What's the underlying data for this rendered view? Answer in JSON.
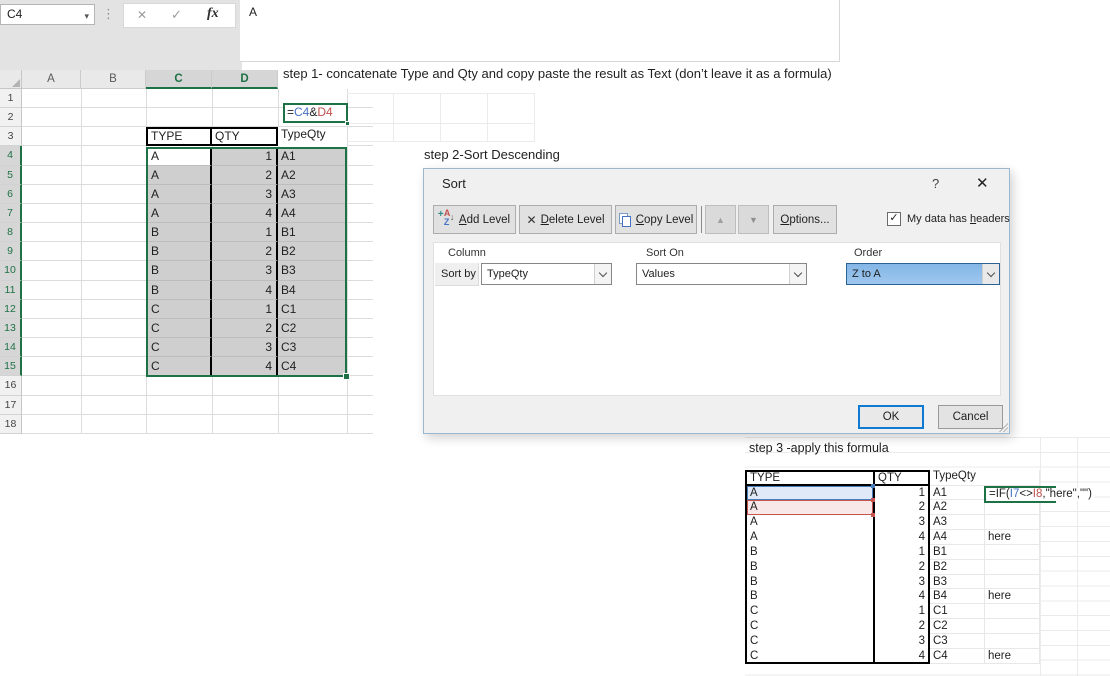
{
  "chrome": {
    "name_box": "C4",
    "formula_bar_value": "A"
  },
  "icons": {
    "name_dropdown": "▾",
    "dots": "⋮",
    "formula_cancel": "✕",
    "formula_enter": "✓",
    "fx": "fx",
    "help": "?",
    "close": "✕",
    "up_arrow": "▲",
    "down_arrow": "▼",
    "delete_x": "✕",
    "check": "✓",
    "add_plus": "+",
    "add_a": "A",
    "add_z": "Z",
    "add_down": "↓"
  },
  "grid": {
    "column_headers": [
      {
        "label": "A",
        "selected": false
      },
      {
        "label": "B",
        "selected": false
      },
      {
        "label": "C",
        "selected": true
      },
      {
        "label": "D",
        "selected": true
      }
    ],
    "rows_total": 18,
    "selected_row_start": 4,
    "selected_row_end": 15,
    "table": {
      "headers": [
        "TYPE",
        "QTY",
        "TypeQty"
      ],
      "types": [
        "A",
        "A",
        "A",
        "A",
        "B",
        "B",
        "B",
        "B",
        "C",
        "C",
        "C",
        "C"
      ],
      "qty": [
        1,
        2,
        3,
        4,
        1,
        2,
        3,
        4,
        1,
        2,
        3,
        4
      ],
      "typeqty": [
        "A1",
        "A2",
        "A3",
        "A4",
        "B1",
        "B2",
        "B3",
        "B4",
        "C1",
        "C2",
        "C3",
        "C4"
      ]
    }
  },
  "step1": {
    "label": "step 1- concatenate Type and Qty and copy paste the result as Text (don’t leave it as a formula)",
    "formula": [
      {
        "t": "="
      },
      {
        "t": "C4",
        "c": "blue"
      },
      {
        "t": "&"
      },
      {
        "t": "D4",
        "c": "red"
      }
    ]
  },
  "step2": {
    "label": "step 2-Sort Descending"
  },
  "sort_dialog": {
    "title": "Sort",
    "toolbar": {
      "add": {
        "label": "Add Level",
        "upos": 0
      },
      "delete": {
        "label": "Delete Level",
        "upos": 0
      },
      "copy": {
        "label": "Copy Level",
        "upos": 0
      },
      "options": {
        "label": "Options...",
        "upos": 0
      },
      "headers_checkbox": {
        "label": "My data has headers",
        "upos": 12,
        "checked": true
      }
    },
    "list_headers": [
      "Column",
      "Sort On",
      "Order"
    ],
    "sort_row": {
      "label": "Sort by",
      "column": "TypeQty",
      "sort_on": "Values",
      "order": "Z to A"
    },
    "ok": "OK",
    "cancel": "Cancel"
  },
  "step3": {
    "label": "step 3 -apply this formula",
    "table": {
      "headers": [
        "TYPE",
        "QTY",
        "TypeQty",
        ""
      ],
      "rows": [
        {
          "type": "A",
          "qty": 1,
          "typeqty": "A1",
          "note": ""
        },
        {
          "type": "A",
          "qty": 2,
          "typeqty": "A2",
          "note": ""
        },
        {
          "type": "A",
          "qty": 3,
          "typeqty": "A3",
          "note": ""
        },
        {
          "type": "A",
          "qty": 4,
          "typeqty": "A4",
          "note": "here"
        },
        {
          "type": "B",
          "qty": 1,
          "typeqty": "B1",
          "note": ""
        },
        {
          "type": "B",
          "qty": 2,
          "typeqty": "B2",
          "note": ""
        },
        {
          "type": "B",
          "qty": 3,
          "typeqty": "B3",
          "note": ""
        },
        {
          "type": "B",
          "qty": 4,
          "typeqty": "B4",
          "note": "here"
        },
        {
          "type": "C",
          "qty": 1,
          "typeqty": "C1",
          "note": ""
        },
        {
          "type": "C",
          "qty": 2,
          "typeqty": "C2",
          "note": ""
        },
        {
          "type": "C",
          "qty": 3,
          "typeqty": "C3",
          "note": ""
        },
        {
          "type": "C",
          "qty": 4,
          "typeqty": "C4",
          "note": "here"
        }
      ]
    },
    "formula": [
      {
        "t": "=IF("
      },
      {
        "t": "I7",
        "c": "blue"
      },
      {
        "t": "<>"
      },
      {
        "t": "I8",
        "c": "red"
      },
      {
        "t": ",\"here\",\"\")"
      }
    ]
  },
  "colors": {
    "excel_green": "#1e7145",
    "ref_blue": "#4472c4",
    "ref_red": "#c0504d",
    "selection_gray": "#cfcfcf",
    "order_highlight": "#8ebde9"
  }
}
